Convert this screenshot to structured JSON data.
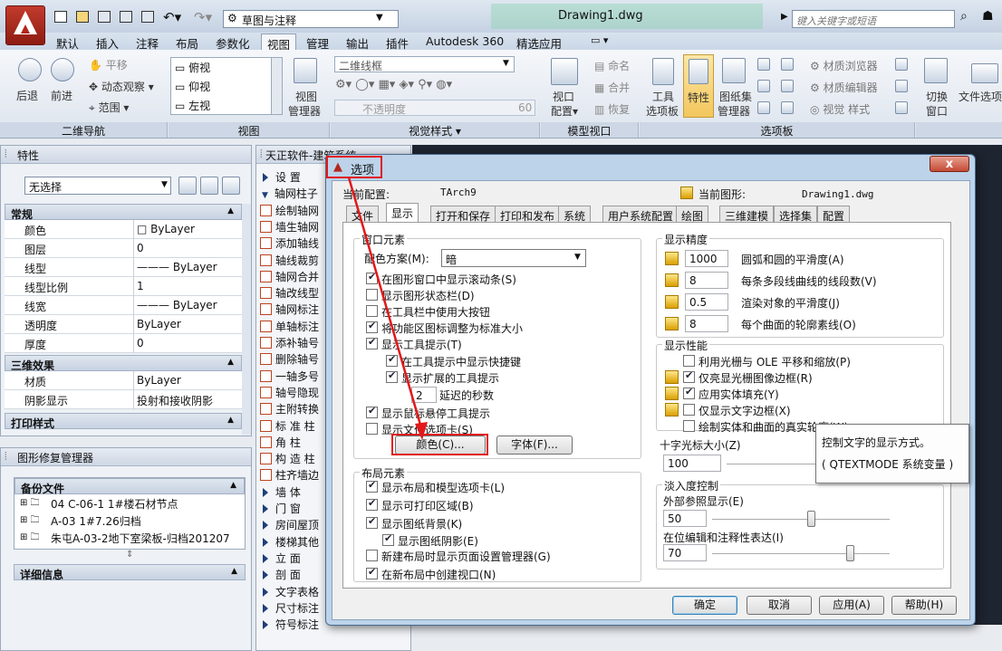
{
  "app": {
    "workspace": "草图与注释",
    "doc_title": "Drawing1.dwg",
    "search_placeholder": "键入关键字或短语"
  },
  "menu_tabs": [
    "默认",
    "插入",
    "注释",
    "布局",
    "参数化",
    "视图",
    "管理",
    "输出",
    "插件",
    "Autodesk 360",
    "精选应用"
  ],
  "ribbon": {
    "nav": {
      "back": "后退",
      "forward": "前进",
      "pan": "平移",
      "orbit": "动态观察",
      "range": "范围",
      "panel": "二维导航"
    },
    "views": {
      "items": [
        "俯视",
        "仰视",
        "左视"
      ],
      "manager": [
        "视图",
        "管理器"
      ],
      "panel": "视图"
    },
    "visual": {
      "style": "二维线框",
      "opacity_label": "不透明度",
      "opacity_value": "60",
      "panel": "视觉样式"
    },
    "model_viewport": {
      "config": [
        "视口",
        "配置"
      ],
      "name": "命名",
      "merge": "合并",
      "restore": "恢复",
      "panel": "模型视口"
    },
    "palettes": {
      "tool": [
        "工具",
        "选项板"
      ],
      "props": "特性",
      "sheetset": [
        "图纸集",
        "管理器"
      ],
      "mat_browser": "材质浏览器",
      "mat_editor": "材质编辑器",
      "visual_style": "视觉 样式",
      "panel": "选项板"
    },
    "window": {
      "switch": [
        "切换",
        "窗口"
      ],
      "file_tabs": "文件选项"
    }
  },
  "properties": {
    "title": "特性",
    "selection": "无选择",
    "sections": {
      "general": "常规",
      "three_d": "三维效果",
      "print": "打印样式"
    },
    "general_rows": [
      {
        "k": "颜色",
        "v": "□ ByLayer"
      },
      {
        "k": "图层",
        "v": "0"
      },
      {
        "k": "线型",
        "v": "——— ByLayer"
      },
      {
        "k": "线型比例",
        "v": "1"
      },
      {
        "k": "线宽",
        "v": "——— ByLayer"
      },
      {
        "k": "透明度",
        "v": "ByLayer"
      },
      {
        "k": "厚度",
        "v": "0"
      }
    ],
    "three_d_rows": [
      {
        "k": "材质",
        "v": "ByLayer"
      },
      {
        "k": "阴影显示",
        "v": "投射和接收阴影"
      }
    ]
  },
  "drawing_manager": {
    "title": "图形修复管理器",
    "backup_section": "备份文件",
    "files": [
      "04 C-06-1 1#楼石材节点",
      "A-03  1#7.26归档",
      "朱屯A-03-2地下室梁板-归档201207"
    ],
    "detail_section": "详细信息"
  },
  "tianzheng": {
    "title": "天正软件-建筑系统",
    "items": [
      {
        "label": "设   置",
        "kind": "arrow"
      },
      {
        "label": "轴网柱子",
        "kind": "arrow-down"
      },
      {
        "label": "绘制轴网",
        "kind": "icon"
      },
      {
        "label": "墙生轴网",
        "kind": "icon"
      },
      {
        "label": "添加轴线",
        "kind": "icon"
      },
      {
        "label": "轴线裁剪",
        "kind": "icon"
      },
      {
        "label": "轴网合并",
        "kind": "icon"
      },
      {
        "label": "轴改线型",
        "kind": "icon"
      },
      {
        "label": "轴网标注",
        "kind": "icon"
      },
      {
        "label": "单轴标注",
        "kind": "icon"
      },
      {
        "label": "添补轴号",
        "kind": "icon"
      },
      {
        "label": "删除轴号",
        "kind": "icon"
      },
      {
        "label": "一轴多号",
        "kind": "icon"
      },
      {
        "label": "轴号隐现",
        "kind": "icon"
      },
      {
        "label": "主附转换",
        "kind": "icon"
      },
      {
        "label": "标 准 柱",
        "kind": "icon"
      },
      {
        "label": "角    柱",
        "kind": "icon"
      },
      {
        "label": "构 造 柱",
        "kind": "icon"
      },
      {
        "label": "柱齐墙边",
        "kind": "icon"
      },
      {
        "label": "墙    体",
        "kind": "arrow"
      },
      {
        "label": "门    窗",
        "kind": "arrow"
      },
      {
        "label": "房间屋顶",
        "kind": "arrow"
      },
      {
        "label": "楼梯其他",
        "kind": "arrow"
      },
      {
        "label": "立    面",
        "kind": "arrow"
      },
      {
        "label": "剖    面",
        "kind": "arrow"
      },
      {
        "label": "文字表格",
        "kind": "arrow"
      },
      {
        "label": "尺寸标注",
        "kind": "arrow"
      },
      {
        "label": "符号标注",
        "kind": "arrow"
      }
    ]
  },
  "dialog": {
    "title": "选项",
    "close": "x",
    "current_profile_label": "当前配置:",
    "current_profile_value": "TArch9",
    "current_drawing_label": "当前图形:",
    "current_drawing_value": "Drawing1.dwg",
    "tabs": [
      "文件",
      "显示",
      "打开和保存",
      "打印和发布",
      "系统",
      "用户系统配置",
      "绘图",
      "三维建模",
      "选择集",
      "配置"
    ],
    "window_elements": {
      "title": "窗口元素",
      "scheme_label": "配色方案(M):",
      "scheme_value": "暗",
      "checks": [
        {
          "label": "在图形窗口中显示滚动条(S)",
          "on": true
        },
        {
          "label": "显示图形状态栏(D)",
          "on": false
        },
        {
          "label": "在工具栏中使用大按钮",
          "on": false
        },
        {
          "label": "将功能区图标调整为标准大小",
          "on": true
        },
        {
          "label": "显示工具提示(T)",
          "on": true
        }
      ],
      "sub_checks": [
        {
          "label": "在工具提示中显示快捷键",
          "on": true
        },
        {
          "label": "显示扩展的工具提示",
          "on": true
        }
      ],
      "delay_value": "2",
      "delay_label": "延迟的秒数",
      "checks2": [
        {
          "label": "显示鼠标悬停工具提示",
          "on": true
        },
        {
          "label": "显示文件选项卡(S)",
          "on": false
        }
      ],
      "color_btn": "颜色(C)...",
      "font_btn": "字体(F)..."
    },
    "layout_elements": {
      "title": "布局元素",
      "checks": [
        {
          "label": "显示布局和模型选项卡(L)",
          "on": true
        },
        {
          "label": "显示可打印区域(B)",
          "on": true
        },
        {
          "label": "显示图纸背景(K)",
          "on": true
        }
      ],
      "sub_check": {
        "label": "显示图纸阴影(E)",
        "on": true
      },
      "checks2": [
        {
          "label": "新建布局时显示页面设置管理器(G)",
          "on": false
        },
        {
          "label": "在新布局中创建视口(N)",
          "on": true
        }
      ]
    },
    "resolution": {
      "title": "显示精度",
      "rows": [
        {
          "value": "1000",
          "label": "圆弧和圆的平滑度(A)"
        },
        {
          "value": "8",
          "label": "每条多段线曲线的线段数(V)"
        },
        {
          "value": "0.5",
          "label": "渲染对象的平滑度(J)"
        },
        {
          "value": "8",
          "label": "每个曲面的轮廓素线(O)"
        }
      ]
    },
    "performance": {
      "title": "显示性能",
      "checks": [
        {
          "label": "利用光栅与 OLE 平移和缩放(P)",
          "on": false
        },
        {
          "label": "仅亮显光栅图像边框(R)",
          "on": true
        },
        {
          "label": "应用实体填充(Y)",
          "on": true
        },
        {
          "label": "仅显示文字边框(X)",
          "on": false
        },
        {
          "label": "绘制实体和曲面的真实轮廓(W)",
          "on": false
        }
      ]
    },
    "crosshair": {
      "title": "十字光标大小(Z)",
      "value": "100"
    },
    "fade": {
      "title": "淡入度控制",
      "xref_label": "外部参照显示(E)",
      "xref_value": "50",
      "inplace_label": "在位编辑和注释性表达(I)",
      "inplace_value": "70"
    },
    "buttons": {
      "ok": "确定",
      "cancel": "取消",
      "apply": "应用(A)",
      "help": "帮助(H)"
    }
  },
  "tooltip": {
    "line1": "控制文字的显示方式。",
    "line2": "( QTEXTMODE 系统变量 )"
  },
  "colors": {
    "accent": "#e1191b",
    "canvas": "#1e2430"
  }
}
